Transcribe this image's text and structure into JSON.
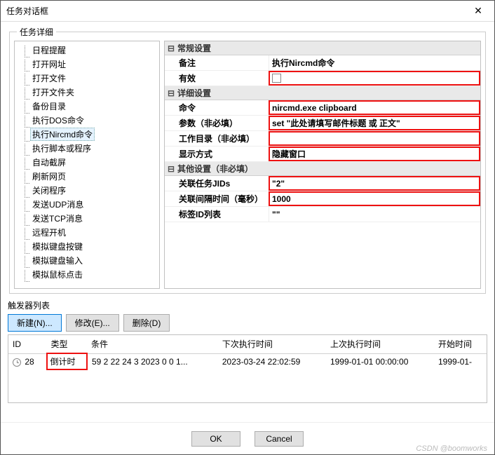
{
  "dialog": {
    "title": "任务对话框",
    "close_glyph": "✕"
  },
  "fieldset_legend": "任务详细",
  "tree": {
    "items": [
      {
        "label": "日程提醒",
        "selected": false
      },
      {
        "label": "打开网址",
        "selected": false
      },
      {
        "label": "打开文件",
        "selected": false
      },
      {
        "label": "打开文件夹",
        "selected": false
      },
      {
        "label": "备份目录",
        "selected": false
      },
      {
        "label": "执行DOS命令",
        "selected": false
      },
      {
        "label": "执行Nircmd命令",
        "selected": true
      },
      {
        "label": "执行脚本或程序",
        "selected": false
      },
      {
        "label": "自动截屏",
        "selected": false
      },
      {
        "label": "刷新网页",
        "selected": false
      },
      {
        "label": "关闭程序",
        "selected": false
      },
      {
        "label": "发送UDP消息",
        "selected": false
      },
      {
        "label": "发送TCP消息",
        "selected": false
      },
      {
        "label": "远程开机",
        "selected": false
      },
      {
        "label": "模拟键盘按键",
        "selected": false
      },
      {
        "label": "模拟键盘输入",
        "selected": false
      },
      {
        "label": "模拟鼠标点击",
        "selected": false
      }
    ]
  },
  "props": {
    "sections": [
      {
        "header": "常规设置",
        "rows": [
          {
            "label": "备注",
            "value": "执行Nircmd命令",
            "highlight": false
          },
          {
            "label": "有效",
            "value": "",
            "is_checkbox": true,
            "highlight": true
          }
        ]
      },
      {
        "header": "详细设置",
        "rows": [
          {
            "label": "命令",
            "value": "nircmd.exe clipboard",
            "highlight": true
          },
          {
            "label": "参数（非必填）",
            "value": "set \"此处请填写邮件标题 或 正文\"",
            "highlight": true
          },
          {
            "label": "工作目录（非必填）",
            "value": "",
            "highlight": true
          },
          {
            "label": "显示方式",
            "value": "隐藏窗口",
            "highlight": true
          }
        ]
      },
      {
        "header": "其他设置（非必填）",
        "rows": [
          {
            "label": "关联任务JIDs",
            "value": "\"2\"",
            "highlight": true
          },
          {
            "label": "关联间隔时间（毫秒）",
            "value": "1000",
            "highlight": true
          },
          {
            "label": "标签ID列表",
            "value": "\"\"",
            "highlight": false
          }
        ]
      }
    ]
  },
  "trigger": {
    "area_label": "触发器列表",
    "buttons": {
      "new": "新建(N)...",
      "edit": "修改(E)...",
      "delete": "删除(D)"
    },
    "columns": [
      "ID",
      "类型",
      "条件",
      "下次执行时间",
      "上次执行时间",
      "开始时间"
    ],
    "rows": [
      {
        "id": "28",
        "type": "倒计时",
        "type_highlight": true,
        "condition": "59 2 22 24 3 2023 0 0 1...",
        "next_time": "2023-03-24 22:02:59",
        "last_time": "1999-01-01 00:00:00",
        "start_time": "1999-01-"
      }
    ]
  },
  "footer": {
    "ok": "OK",
    "cancel": "Cancel"
  },
  "watermark": "CSDN @boomworks"
}
